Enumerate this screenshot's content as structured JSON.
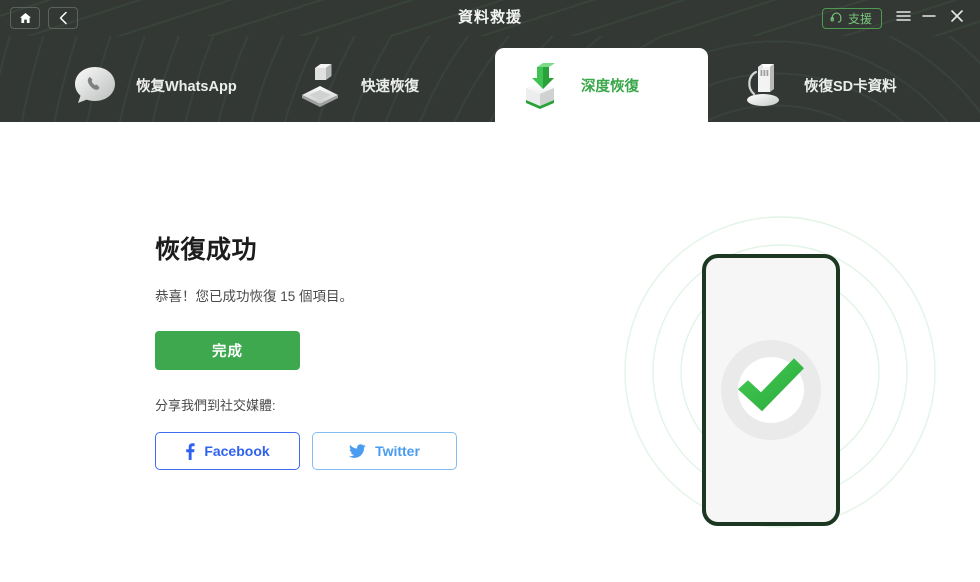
{
  "window": {
    "title": "資料救援",
    "home_icon": "home-icon",
    "back_icon": "chevron-left-icon",
    "support_label": "支援",
    "support_icon": "headset-icon",
    "menu_icon": "hamburger-menu-icon",
    "minimize_icon": "minimize-icon",
    "close_icon": "close-icon",
    "titlebar_bg": "#333835",
    "accent_green": "#3da84e",
    "support_green": "#79c47c"
  },
  "tabs": [
    {
      "label": "恢复WhatsApp",
      "icon": "whatsapp-phone-bubble-icon",
      "active": false
    },
    {
      "label": "快速恢復",
      "icon": "quick-recovery-scanner-icon",
      "active": false
    },
    {
      "label": "深度恢復",
      "icon": "deep-recovery-box-arrow-icon",
      "active": true
    },
    {
      "label": "恢復SD卡資料",
      "icon": "sd-card-icon",
      "active": false
    }
  ],
  "main": {
    "headline": "恢復成功",
    "subtext": "恭喜！您已成功恢復 15 個項目。",
    "recovered_count": "15",
    "done_label": "完成",
    "share_label": "分享我們到社交媒體:",
    "social": [
      {
        "label": "Facebook",
        "icon": "facebook-icon",
        "color": "#2f62f0"
      },
      {
        "label": "Twitter",
        "icon": "twitter-bird-icon",
        "color": "#4a9cf0"
      }
    ]
  },
  "illustration": {
    "name": "phone-success-checkmark-illustration",
    "check_icon": "checkmark-icon",
    "phone_border_color": "#1c3722",
    "check_color": "#3cc14b",
    "ring_color": "#e4f5e6"
  }
}
